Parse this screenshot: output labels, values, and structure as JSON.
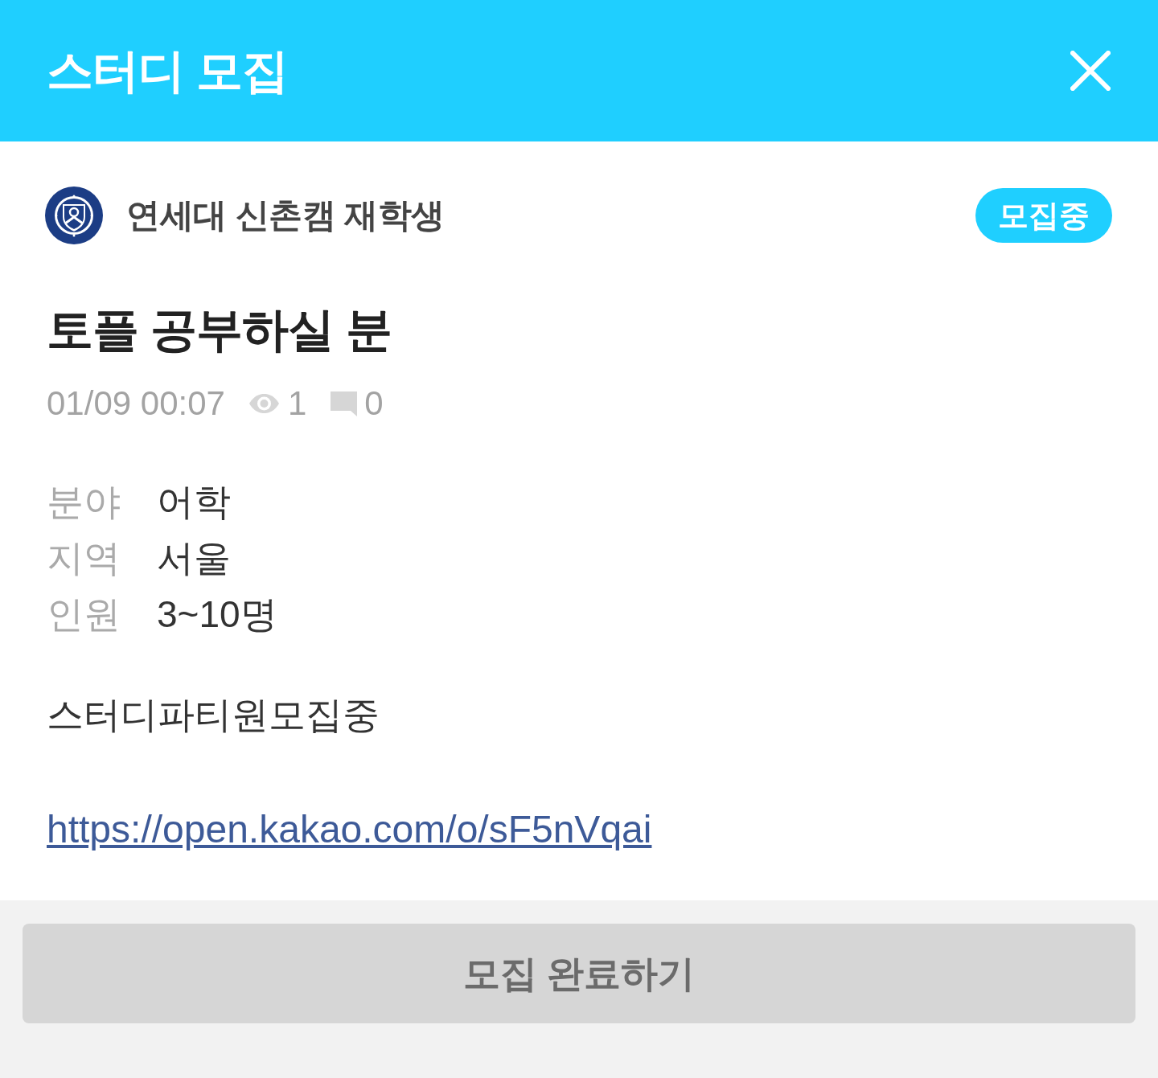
{
  "header": {
    "title": "스터디 모집"
  },
  "author": {
    "name": "연세대 신촌캠 재학생",
    "status": "모집중"
  },
  "post": {
    "title": "토플 공부하실 분",
    "date": "01/09 00:07",
    "views": "1",
    "comments": "0"
  },
  "details": [
    {
      "label": "분야",
      "value": "어학"
    },
    {
      "label": "지역",
      "value": "서울"
    },
    {
      "label": "인원",
      "value": "3~10명"
    }
  ],
  "description": "스터디파티원모집중",
  "link": "https://open.kakao.com/o/sF5nVqai",
  "footer": {
    "button": "모집 완료하기"
  }
}
